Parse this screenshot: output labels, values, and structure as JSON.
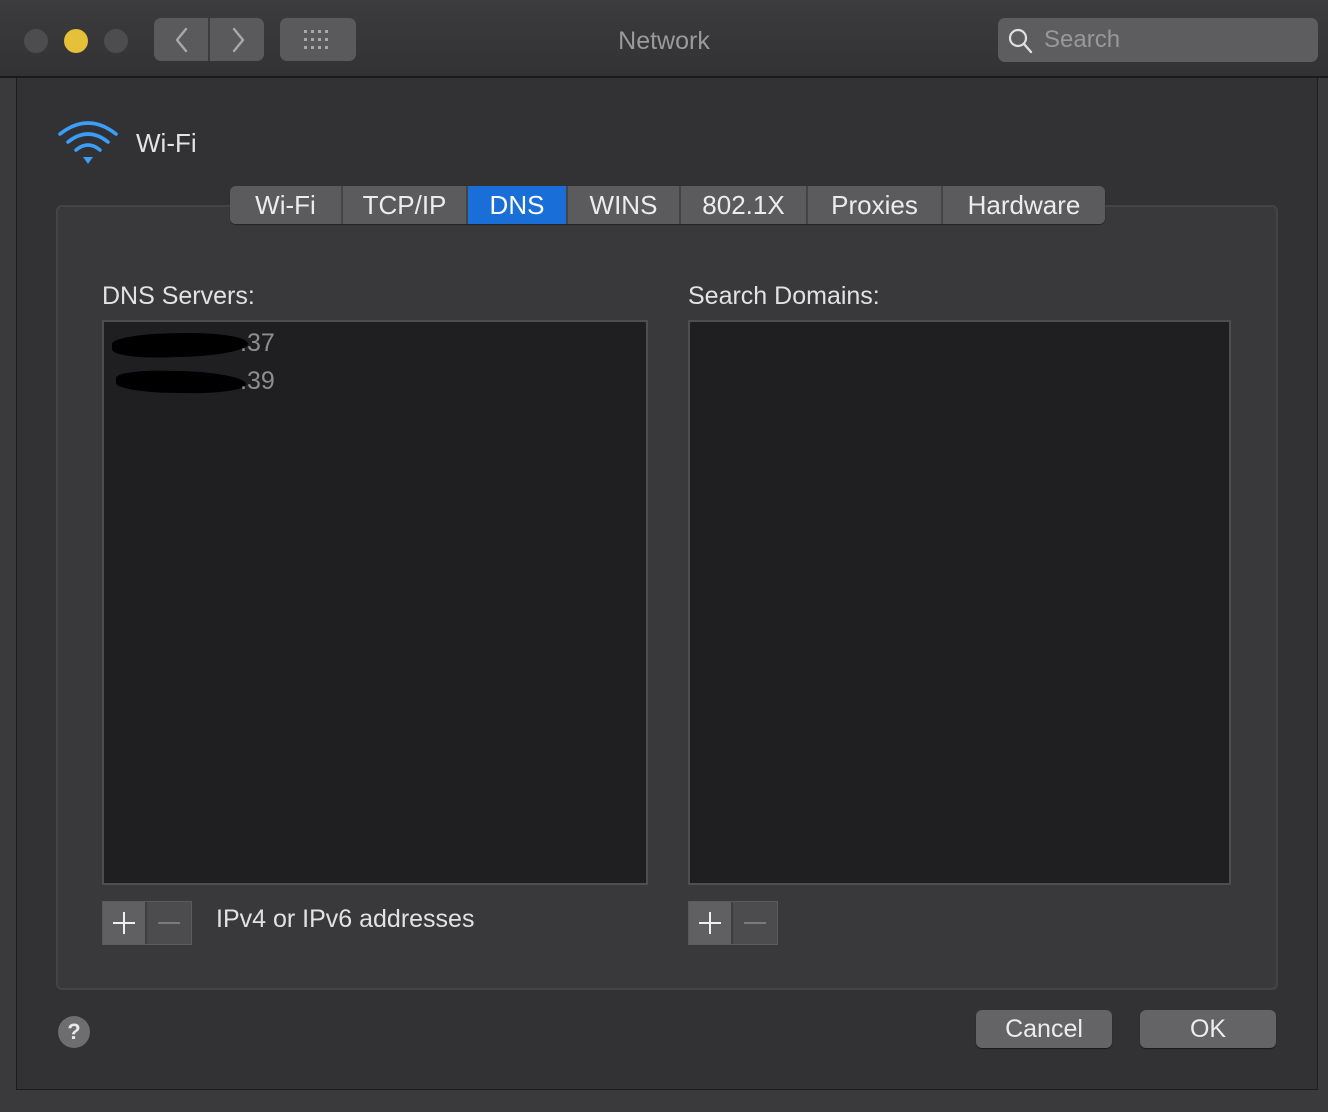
{
  "window": {
    "title": "Network",
    "search_placeholder": "Search",
    "traffic_lights": [
      "#4d4d4f",
      "#e6c039",
      "#4d4d4f"
    ]
  },
  "interface": {
    "name": "Wi-Fi",
    "icon": "wifi-icon",
    "accent": "#3b9dfc"
  },
  "tabs": [
    {
      "label": "Wi-Fi",
      "active": false
    },
    {
      "label": "TCP/IP",
      "active": false
    },
    {
      "label": "DNS",
      "active": true
    },
    {
      "label": "WINS",
      "active": false
    },
    {
      "label": "802.1X",
      "active": false
    },
    {
      "label": "Proxies",
      "active": false
    },
    {
      "label": "Hardware",
      "active": false
    }
  ],
  "dns": {
    "servers_label": "DNS Servers:",
    "servers": [
      ".37",
      ".39"
    ],
    "hint": "IPv4 or IPv6 addresses"
  },
  "search_domains": {
    "label": "Search Domains:",
    "items": []
  },
  "buttons": {
    "cancel": "Cancel",
    "ok": "OK",
    "help": "?"
  }
}
